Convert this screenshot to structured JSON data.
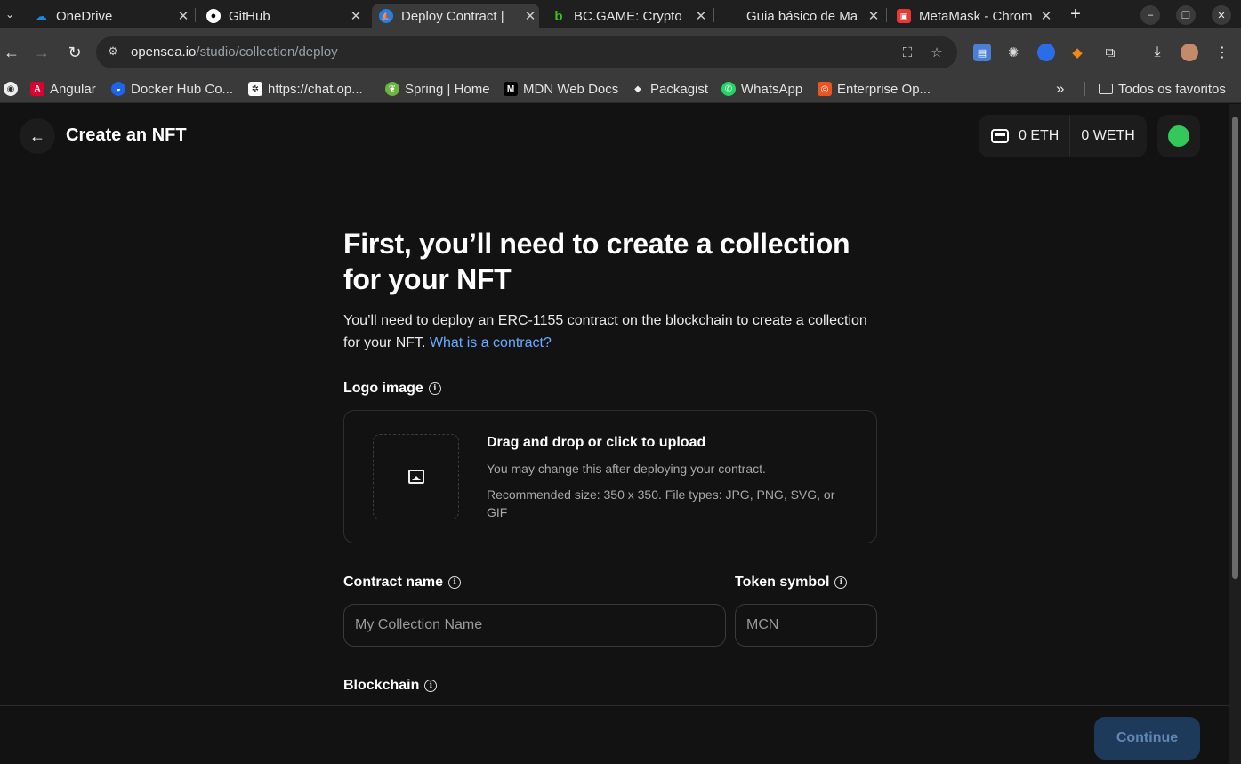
{
  "browser": {
    "tabs": [
      {
        "title": "OneDrive",
        "icon": "onedrive-icon",
        "color": "#1e88e5"
      },
      {
        "title": "GitHub",
        "icon": "github-icon",
        "color": "#ffffff"
      },
      {
        "title": "Deploy Contract | ",
        "icon": "opensea-icon",
        "color": "#2081e2",
        "active": true
      },
      {
        "title": "BC.GAME: Crypto ",
        "icon": "bcgame-icon",
        "color": "#3bc117"
      },
      {
        "title": "Guia básico de Ma",
        "icon": "blank-page-icon",
        "color": "#3a3a3a"
      },
      {
        "title": "MetaMask - Chrom",
        "icon": "chrome-webstore-icon",
        "color": "#e53935"
      }
    ],
    "url_domain": "opensea.io",
    "url_path": "/studio/collection/deploy",
    "bookmarks": [
      {
        "label": "Angular",
        "icon": "angular-icon",
        "color": "#dd0031"
      },
      {
        "label": "Docker Hub Co...",
        "icon": "docker-icon",
        "color": "#1d63ed"
      },
      {
        "label": "https://chat.op...",
        "icon": "openai-icon",
        "color": "#ffffff"
      },
      {
        "label": "Spring | Home",
        "icon": "spring-icon",
        "color": "#6db33f"
      },
      {
        "label": "MDN Web Docs",
        "icon": "mdn-icon",
        "color": "#000000"
      },
      {
        "label": "Packagist",
        "icon": "packagist-icon",
        "color": "#f28d1a"
      },
      {
        "label": "WhatsApp",
        "icon": "whatsapp-icon",
        "color": "#25d366"
      },
      {
        "label": "Enterprise Op...",
        "icon": "ubuntu-icon",
        "color": "#e95420"
      }
    ],
    "all_bookmarks_label": "Todos os favoritos"
  },
  "header": {
    "title": "Create an NFT",
    "eth_balance": "0 ETH",
    "weth_balance": "0 WETH",
    "status_color": "#34c759"
  },
  "main": {
    "headline": "First, you’ll need to create a collection for your NFT",
    "intro_text": "You’ll need to deploy an ERC-1155 contract on the blockchain to create a collection for your NFT. ",
    "intro_link": "What is a contract?",
    "logo_label": "Logo image",
    "upload_title": "Drag and drop or click to upload",
    "upload_subtitle": "You may change this after deploying your contract.",
    "upload_recommend": "Recommended size: 350 x 350. File types: JPG, PNG, SVG, or GIF",
    "contract_name_label": "Contract name",
    "contract_name_placeholder": "My Collection Name",
    "token_symbol_label": "Token symbol",
    "token_symbol_placeholder": "MCN",
    "blockchain_label": "Blockchain"
  },
  "footer": {
    "continue_label": "Continue"
  }
}
